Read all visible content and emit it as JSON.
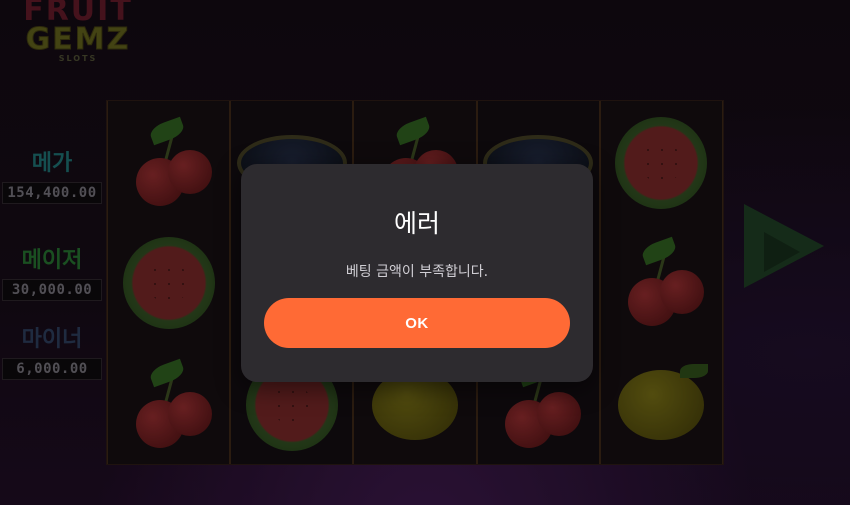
{
  "game": {
    "logo": {
      "line1": "FRUIT",
      "line2": "GEMZ",
      "line3": "SLOTS"
    },
    "jackpots": [
      {
        "label": "메가",
        "value": "154,400.00"
      },
      {
        "label": "메이저",
        "value": "30,000.00"
      },
      {
        "label": "마이너",
        "value": "6,000.00"
      }
    ],
    "reels": [
      [
        "cherry",
        "melon",
        "cherry"
      ],
      [
        "gem",
        "melon",
        "melon"
      ],
      [
        "cherry",
        "cherry",
        "lemon"
      ],
      [
        "gem",
        "cherry",
        "cherry"
      ],
      [
        "melon",
        "cherry",
        "lemon"
      ]
    ],
    "play_icon": "play-triangle-icon"
  },
  "dialog": {
    "title": "에러",
    "message": "베팅 금액이 부족합니다.",
    "ok_label": "OK",
    "accent_color": "#ff6a35",
    "background_color": "#2d2b2f"
  }
}
